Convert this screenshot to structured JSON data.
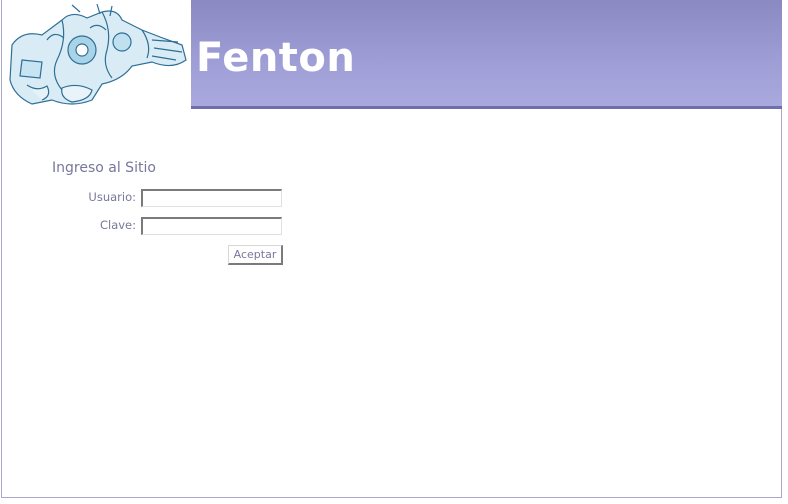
{
  "header": {
    "title": "Fenton",
    "logo_icon": "robot-illustration"
  },
  "login": {
    "title": "Ingreso al Sitio",
    "user_label": "Usuario:",
    "user_value": "",
    "password_label": "Clave:",
    "password_value": "",
    "submit_label": "Aceptar"
  },
  "colors": {
    "header_gradient_top": "#8a89c2",
    "header_gradient_bottom": "#aaa9de",
    "text_accent": "#77779c"
  }
}
